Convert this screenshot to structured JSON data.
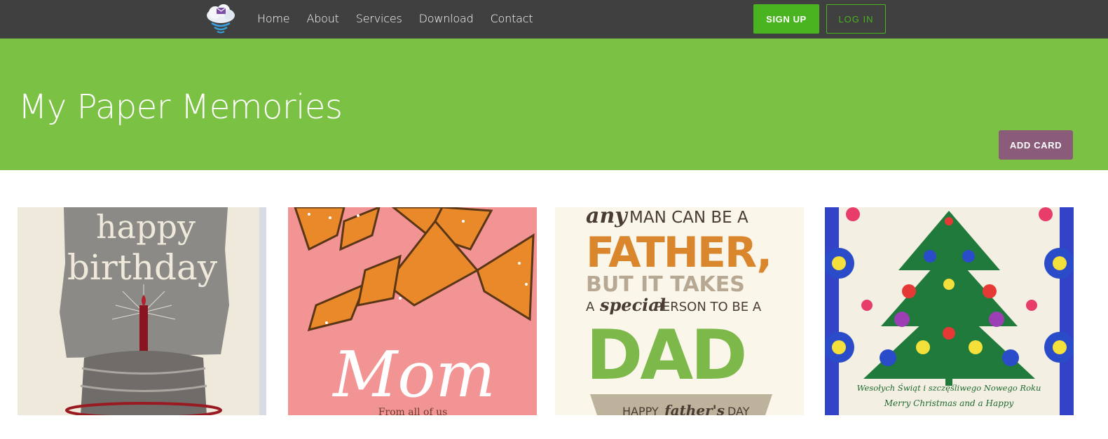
{
  "nav": {
    "logo_icon": "cloud-envelope-icon",
    "links": [
      "Home",
      "About",
      "Services",
      "Download",
      "Contact"
    ],
    "signup_label": "SIGN UP",
    "login_label": "LOG IN"
  },
  "hero": {
    "title": "My Paper Memories",
    "add_card_label": "ADD CARD"
  },
  "colors": {
    "navbar": "#404040",
    "accent_green": "#49b41f",
    "hero_green": "#7bc143",
    "add_button": "#8b5b7a"
  },
  "cards": [
    {
      "image": "happy-birthday-card",
      "text_lines": [
        "happy",
        "birthday"
      ]
    },
    {
      "image": "mom-butterflies-card",
      "text_lines": [
        "Mom",
        "From all of us"
      ]
    },
    {
      "image": "fathers-day-card",
      "text_lines": [
        "any",
        "MAN CAN BE A",
        "FATHER,",
        "BUT IT TAKES",
        "A",
        "special",
        "PERSON TO BE A",
        "DAD",
        "HAPPY",
        "father's",
        "DAY"
      ]
    },
    {
      "image": "christmas-tree-folk-card",
      "text_lines": [
        "Wesołych Świąt i szczęśliwego Nowego Roku",
        "Merry Christmas and a Happy"
      ]
    }
  ]
}
